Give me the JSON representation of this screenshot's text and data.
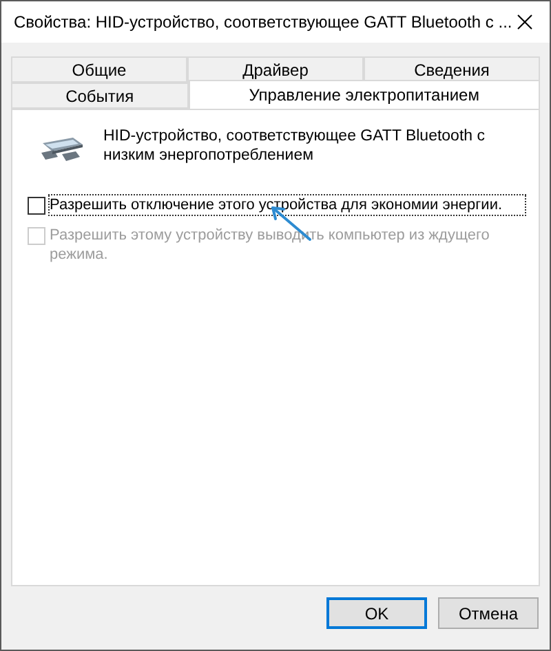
{
  "window": {
    "title": "Свойства: HID-устройство, соответствующее GATT Bluetooth с ..."
  },
  "tab_rows": [
    [
      {
        "label": "Общие",
        "selected": false
      },
      {
        "label": "Драйвер",
        "selected": false
      },
      {
        "label": "Сведения",
        "selected": false
      }
    ],
    [
      {
        "label": "События",
        "selected": false
      },
      {
        "label": "Управление электропитанием",
        "selected": true
      }
    ]
  ],
  "device": {
    "name": "HID-устройство, соответствующее GATT Bluetooth с низким энергопотреблением"
  },
  "options": [
    {
      "label": "Разрешить отключение этого устройства для экономии энергии.",
      "checked": false,
      "disabled": false,
      "focused": true
    },
    {
      "label": "Разрешить этому устройству выводить компьютер из ждущего режима.",
      "checked": false,
      "disabled": true,
      "focused": false
    }
  ],
  "buttons": [
    {
      "label": "OK",
      "default": true
    },
    {
      "label": "Отмена",
      "default": false
    }
  ]
}
